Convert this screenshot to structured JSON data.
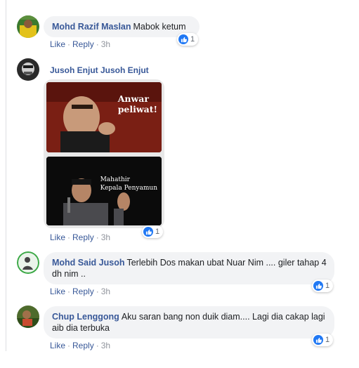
{
  "comments": [
    {
      "author": "Mohd Razif Maslan",
      "text": "Mabok ketum",
      "actions": {
        "like": "Like",
        "reply": "Reply",
        "time": "3h"
      },
      "reaction_count": "1"
    },
    {
      "author": "Jusoh Enjut Jusoh Enjut",
      "meme_caption_top": "Anwar\npeliwat!",
      "meme_caption_bottom": "Mahathir\nKepala Penyamun",
      "actions": {
        "like": "Like",
        "reply": "Reply",
        "time": "3h"
      },
      "reaction_count": "1"
    },
    {
      "author": "Mohd Said Jusoh",
      "text": "Terlebih Dos makan ubat Nuar Nim .... giler tahap 4 dh nim ..",
      "actions": {
        "like": "Like",
        "reply": "Reply",
        "time": "3h"
      },
      "reaction_count": "1"
    },
    {
      "author": "Chup Lenggong",
      "text": "Aku saran bang non duik diam.... Lagi dia cakap lagi aib dia terbuka",
      "actions": {
        "like": "Like",
        "reply": "Reply",
        "time": "3h"
      },
      "reaction_count": "1"
    }
  ],
  "colors": {
    "link": "#385898",
    "bubble": "#f2f3f5",
    "like_blue": "#2078f4",
    "muted": "#90949c"
  },
  "icons": {
    "reaction": "thumbs-up-icon"
  }
}
